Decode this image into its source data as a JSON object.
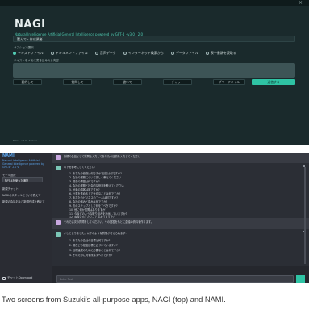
{
  "nagi": {
    "title": "NAGI",
    "subtitle": "Natural-Intelligence Artificial General Intelligence powered by GPT-4 · v3.0 · 2.0",
    "close": "×",
    "select_value": "選んで・作成業者",
    "option_label": "オプション選択",
    "radio_options": [
      {
        "label": "テキストファイル",
        "selected": true
      },
      {
        "label": "ドキュメントファイル",
        "selected": false
      },
      {
        "label": "音声データ",
        "selected": false
      },
      {
        "label": "インターネット検索から",
        "selected": false
      },
      {
        "label": "データファイル",
        "selected": false
      },
      {
        "label": "表や書類を読取る",
        "selected": false
      }
    ],
    "textarea_label": "テキストをメモに書き込みれる内容",
    "buttons": [
      "要約して",
      "質問して",
      "書いて",
      "チャット",
      "ブリーフメイル",
      "送信する"
    ],
    "footer": "NAGI · v3.0 · Suzuki"
  },
  "nami": {
    "name": "NAMI",
    "description": "Natural-Intelligence Artificial General Intelligence powered by GPT-4 · 2.0 v",
    "model_label": "モデル選択",
    "model_value": "GPT-4を使った通訳",
    "history": [
      "新規チャット",
      "NAGIのスタイルについて教えて",
      "新規の会話および新規作成を教えて"
    ],
    "download": "チャットDownload",
    "input_placeholder": "Enter Text",
    "messages": [
      {
        "role": "user",
        "text": "新規の会話として質問を入力してあなたの目的を入力してください"
      },
      {
        "role": "bot",
        "text": "以下を参考にしてください:",
        "items": [
          "1. あなたの役割は何ですか?目的は何ですか?",
          "2. 会社の業務について詳しく教えてください",
          "3. 現在の課題は何ですか?",
          "4. 会社の業務と社会的な役割を教えてください",
          "5. 対象の顧客は誰ですか?",
          "6. 仕事を進める上で大切なことは何ですか?",
          "7. あなたのビジネスのゴールは何ですか?",
          "8. 会社の強みと弱みは何ですか?",
          "9. 次のステップとして何をすべきですか?",
          "10. 他に何か質問はありますか?",
          "11. 今後どのような取り組みを計画していますか?",
          "12. 最後に伝えたいことはありますか?"
        ]
      },
      {
        "role": "user",
        "text": "それでは次の質問をしてください。その回答をもとに会議の資料を作ります。"
      },
      {
        "role": "bot",
        "text": "かしこまりました。以下のような質問が考えられます:",
        "items": [
          "1. あなたの会社の目標は何ですか?",
          "2. 現在どの程度目標に近づいていますか?",
          "3. 目標達成のために必要なことは何ですか?",
          "4. そのために何を改善すべきですか?"
        ]
      }
    ]
  },
  "caption": "Two screens from Suzuki's all-purpose apps, NAGI (top) and NAMI."
}
